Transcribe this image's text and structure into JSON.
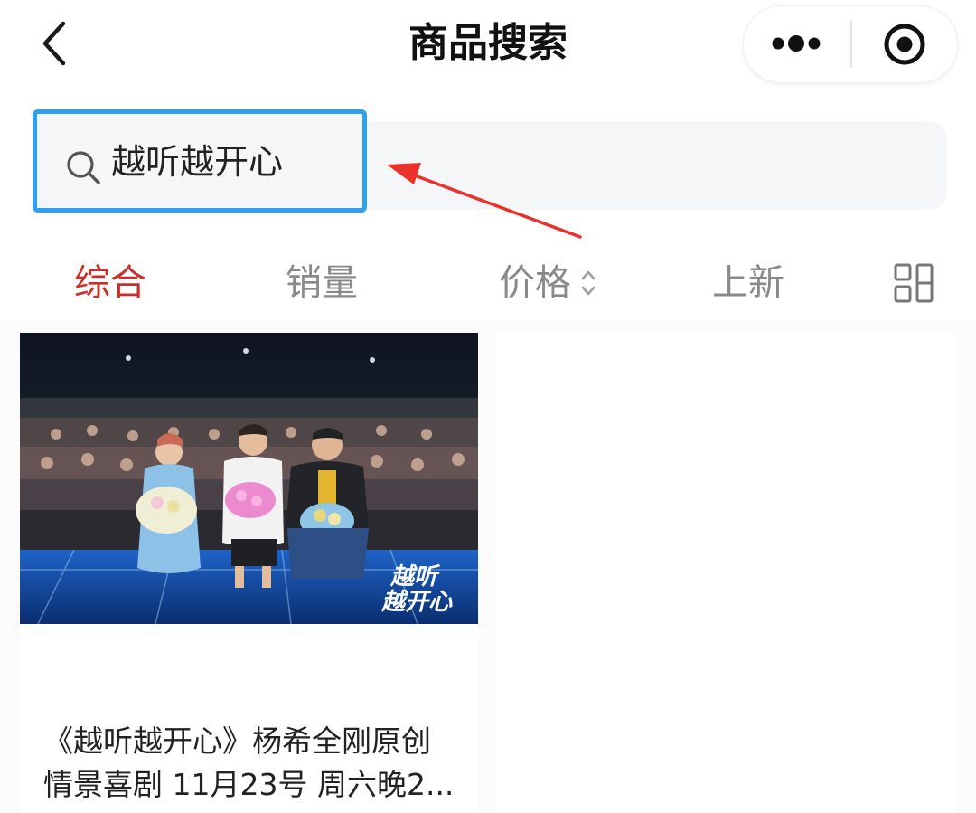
{
  "header": {
    "title": "商品搜索",
    "back_icon": "chevron-left-icon",
    "more_icon": "more-dots-icon",
    "close_icon": "record-circle-icon"
  },
  "search": {
    "value": "越听越开心",
    "icon": "search-icon",
    "highlight_color": "#2f9ff2",
    "annotation_color": "#e8322b"
  },
  "sort_tabs": [
    {
      "label": "综合",
      "active": true
    },
    {
      "label": "销量",
      "active": false
    },
    {
      "label": "价格",
      "active": false,
      "icon": "sort-updown-icon"
    },
    {
      "label": "上新",
      "active": false
    }
  ],
  "layout_toggle_icon": "grid-view-icon",
  "active_color": "#c8302b",
  "products": [
    {
      "title_line1": "《越听越开心》杨希全刚原创",
      "title_line2": "情景喜剧 11月23号 周六晚2...",
      "image": {
        "overlay_line1": "越听",
        "overlay_line2": "越开心"
      }
    }
  ]
}
